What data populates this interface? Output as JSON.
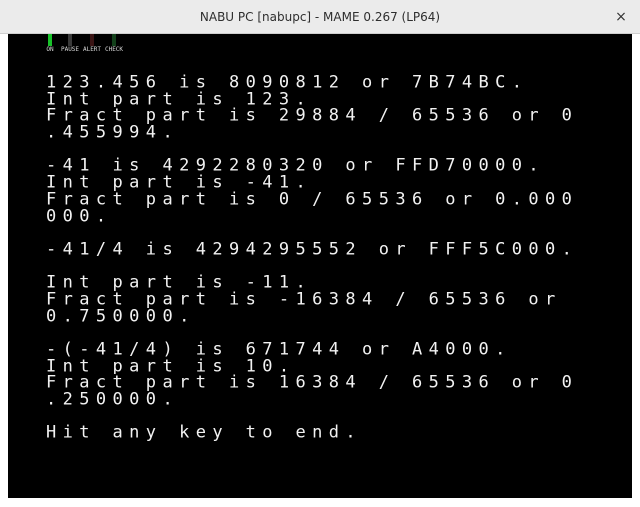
{
  "window": {
    "title": "NABU PC [nabupc] - MAME 0.267 (LP64)",
    "close_label": "×"
  },
  "leds": [
    {
      "label": "ON",
      "color": "#19c22a",
      "lit": true
    },
    {
      "label": "PAUSE",
      "color": "#3a3a3a",
      "lit": false
    },
    {
      "label": "ALERT",
      "color": "#3a1414",
      "lit": false
    },
    {
      "label": "CHECK",
      "color": "#12401a",
      "lit": false
    }
  ],
  "screen": {
    "lines": [
      "123.456 is 8090812 or 7B74BC.",
      "Int part is 123.",
      "Fract part is 29884 / 65536 or 0",
      ".455994.",
      "",
      "-41 is 4292280320 or FFD70000.",
      "Int part is -41.",
      "Fract part is 0 / 65536 or 0.000",
      "000.",
      "",
      "-41/4 is 4294295552 or FFF5C000.",
      "",
      "Int part is -11.",
      "Fract part is -16384 / 65536 or",
      "0.750000.",
      "",
      "-(-41/4) is 671744 or A4000.",
      "Int part is 10.",
      "Fract part is 16384 / 65536 or 0",
      ".250000.",
      "",
      "Hit any key to end.",
      "",
      ""
    ]
  }
}
